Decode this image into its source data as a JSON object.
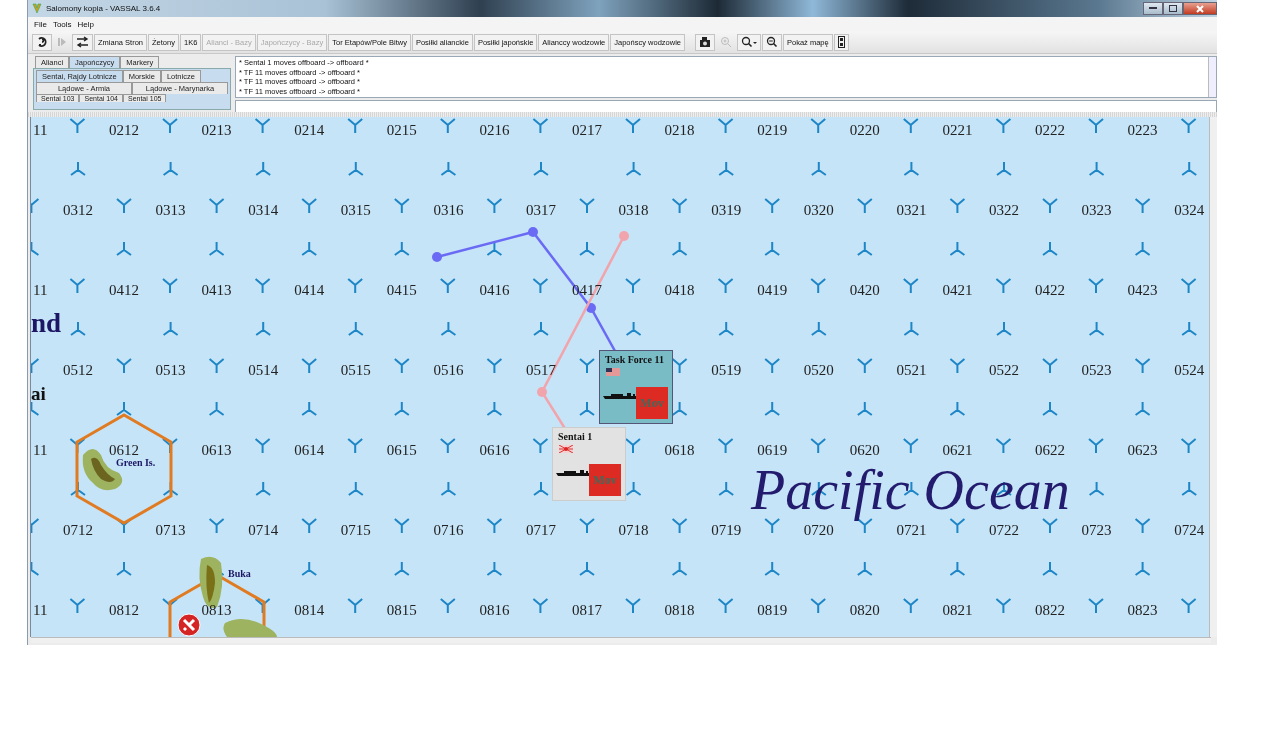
{
  "window": {
    "title": "Salomony kopia - VASSAL 3.6.4"
  },
  "menu": [
    "File",
    "Tools",
    "Help"
  ],
  "toolbar": {
    "left_icons": [
      {
        "disabled": false
      },
      {
        "disabled": true
      },
      {
        "disabled": false
      }
    ],
    "buttons": [
      {
        "label": "Zmiana Stron",
        "disabled": false
      },
      {
        "label": "Żetony",
        "disabled": false
      },
      {
        "label": "1K6",
        "disabled": false
      },
      {
        "label": "Alianci - Bazy",
        "disabled": true
      },
      {
        "label": "Japończycy - Bazy",
        "disabled": true
      },
      {
        "label": "Tor Etapów/Pole Bitwy",
        "disabled": false
      },
      {
        "label": "Posiłki alianckie",
        "disabled": false
      },
      {
        "label": "Posiłki japońskie",
        "disabled": false
      },
      {
        "label": "Alianccy wodzowie",
        "disabled": false
      },
      {
        "label": "Japońscy wodzowie",
        "disabled": false
      }
    ],
    "right_tools": [
      {
        "kind": "icon",
        "disabled": false
      },
      {
        "kind": "icon",
        "disabled": true
      },
      {
        "kind": "icon",
        "disabled": false
      },
      {
        "kind": "icon",
        "disabled": false
      },
      {
        "kind": "text",
        "label": "Pokaż mapę",
        "disabled": false
      },
      {
        "kind": "icon",
        "disabled": false
      }
    ]
  },
  "piece_palette": {
    "tabs": [
      {
        "label": "Alianci",
        "selected": false
      },
      {
        "label": "Japończycy",
        "selected": true
      },
      {
        "label": "Markery",
        "selected": false
      }
    ],
    "category_rows": [
      [
        {
          "label": "Sentai, Rajdy Lotnicze",
          "selected": true
        },
        {
          "label": "Morskie",
          "selected": false
        },
        {
          "label": "Lotnicze",
          "selected": false
        }
      ],
      [
        {
          "label": "Lądowe - Armia",
          "selected": false
        },
        {
          "label": "Lądowe - Marynarka",
          "selected": false
        }
      ]
    ],
    "group_tabs": [
      {
        "label": "Sentai 103",
        "selected": false
      },
      {
        "label": "Sentai 104",
        "selected": false
      },
      {
        "label": "Sentai 105",
        "selected": false
      }
    ]
  },
  "chat_log": {
    "lines": [
      "* Sentai 1 moves offboard -> offboard *",
      "* TF 11 moves offboard -> offboard *",
      "* TF 11 moves offboard -> offboard *",
      "* TF 11 moves offboard -> offboard *"
    ]
  },
  "map": {
    "hex_rows": [
      {
        "labels": [
          "11",
          "0212",
          "0213",
          "0214",
          "0215",
          "0216",
          "0217",
          "0218",
          "0219",
          "0220",
          "0221",
          "0222",
          "0223"
        ]
      },
      {
        "labels": [
          "0312",
          "0313",
          "0314",
          "0315",
          "0316",
          "0317",
          "0318",
          "0319",
          "0320",
          "0321",
          "0322",
          "0323",
          "0324"
        ]
      },
      {
        "labels": [
          "11",
          "0412",
          "0413",
          "0414",
          "0415",
          "0416",
          "0417",
          "0418",
          "0419",
          "0420",
          "0421",
          "0422",
          "0423"
        ]
      },
      {
        "labels": [
          "0512",
          "0513",
          "0514",
          "0515",
          "0516",
          "0517",
          "0519",
          "0520",
          "0521",
          "0522",
          "0523",
          "0524"
        ]
      },
      {
        "labels": [
          "11",
          "0612",
          "0613",
          "0614",
          "0615",
          "0616",
          "0618",
          "0619",
          "0620",
          "0621",
          "0622",
          "0623"
        ]
      },
      {
        "labels": [
          "0712",
          "0713",
          "0714",
          "0715",
          "0716",
          "0717",
          "0718",
          "0719",
          "0720",
          "0721",
          "0722",
          "0723",
          "0724"
        ]
      },
      {
        "labels": [
          "11",
          "0812",
          "0813",
          "0814",
          "0815",
          "0816",
          "0817",
          "0818",
          "0819",
          "0820",
          "0821",
          "0822",
          "0823"
        ]
      }
    ],
    "regions": [
      {
        "label": "nd",
        "kind": "large"
      },
      {
        "label": "ai",
        "kind": "small"
      }
    ],
    "islands": [
      {
        "label": "Green Is."
      },
      {
        "label": "Buka"
      }
    ],
    "sea_label": "Pacific Ocean",
    "movement_trails": [
      {
        "color": "#6a6af5"
      },
      {
        "color": "#f2a4ac"
      }
    ],
    "counters": [
      {
        "kind": "allied",
        "title": "Task Force 11",
        "status": "Mov"
      },
      {
        "kind": "japanese",
        "title": "Sentai 1",
        "status": "Mov"
      }
    ]
  }
}
